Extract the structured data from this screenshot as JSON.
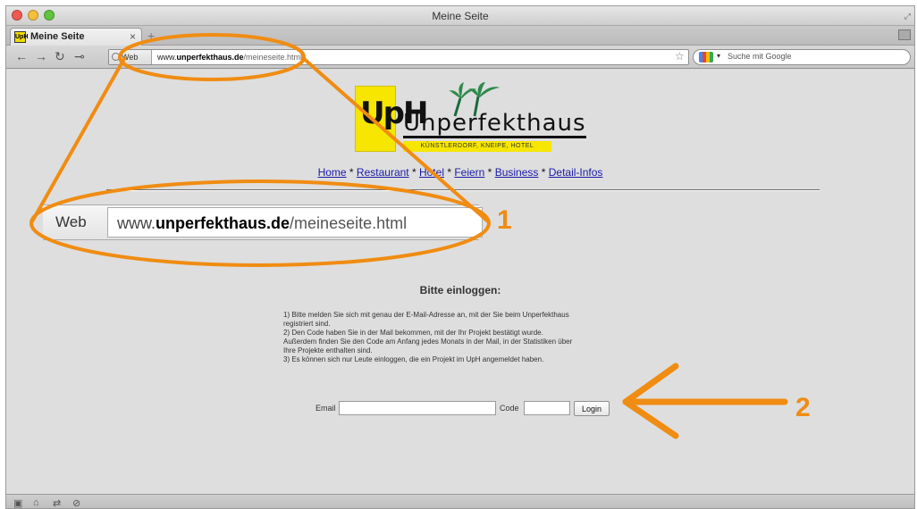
{
  "window": {
    "title": "Meine Seite"
  },
  "tab": {
    "title": "Meine Seite",
    "favicon_text": "UpH",
    "close": "×",
    "new_tab": "+"
  },
  "navbar": {
    "url_prefix_label": "Web",
    "url_domain_main": "www.",
    "url_domain_bold": "unperfekthaus.de",
    "url_path": "/meineseite.html",
    "search_placeholder": "Suche mit Google"
  },
  "site": {
    "logo": {
      "mark": "UpH",
      "name": "Unperfekthaus",
      "tagline": "KÜNSTLERDORF, KNEIPE, HOTEL"
    },
    "nav": {
      "items": [
        "Home",
        "Restaurant",
        "Hotel",
        "Feiern",
        "Business",
        "Detail-Infos"
      ],
      "separator": " * "
    },
    "heading": "Bitte einloggen:",
    "instructions": [
      "1) Bitte melden Sie sich mit genau der E-Mail-Adresse an, mit der Sie beim Unperfekthaus",
      "registriert sind.",
      "2) Den Code haben Sie in der Mail bekommen, mit der Ihr Projekt bestätigt wurde.",
      "Außerdem finden Sie den Code am Anfang jedes Monats in der Mail, in der Statistiken über",
      "Ihre Projekte enthalten sind.",
      "3) Es können sich nur Leute einloggen, die ein Projekt im UpH angemeldet haben."
    ],
    "form": {
      "email_label": "Email",
      "email_value": "",
      "code_label": "Code",
      "code_value": "",
      "login_button": "Login"
    }
  },
  "annotations": {
    "zoom_web_label": "Web",
    "zoom_url_main": "www.",
    "zoom_url_bold": "unperfekthaus.de",
    "zoom_url_path": "/meineseite.html",
    "marker_1": "1",
    "marker_2": "2",
    "color": "#f08c12"
  },
  "colors": {
    "link": "#1a1aaa",
    "logo_yellow": "#f6e600",
    "page_bg": "#dedede"
  }
}
